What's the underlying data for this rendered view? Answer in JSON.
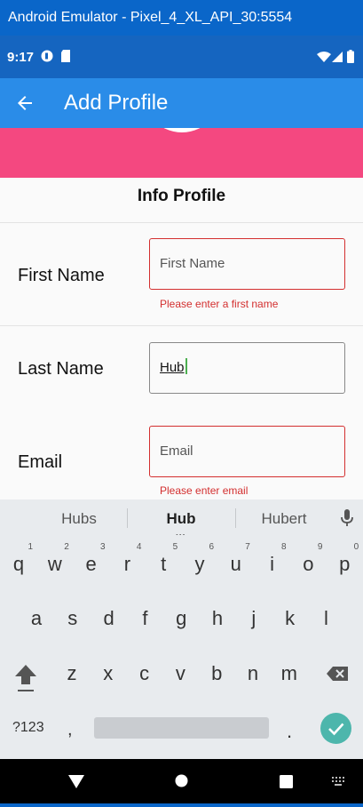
{
  "window": {
    "title": "Android Emulator - Pixel_4_XL_API_30:5554"
  },
  "status_bar": {
    "time": "9:17"
  },
  "app_bar": {
    "title": "Add Profile"
  },
  "section": {
    "title": "Info Profile"
  },
  "form": {
    "first_name": {
      "label": "First Name",
      "placeholder": "First Name",
      "value": "",
      "error": "Please enter a first name"
    },
    "last_name": {
      "label": "Last Name",
      "value": "Hub"
    },
    "email": {
      "label": "Email",
      "placeholder": "Email",
      "value": "",
      "error": "Please enter email"
    }
  },
  "suggestions": [
    "Hubs",
    "Hub",
    "Hubert"
  ],
  "keyboard": {
    "row1": [
      {
        "k": "q",
        "n": "1"
      },
      {
        "k": "w",
        "n": "2"
      },
      {
        "k": "e",
        "n": "3"
      },
      {
        "k": "r",
        "n": "4"
      },
      {
        "k": "t",
        "n": "5"
      },
      {
        "k": "y",
        "n": "6"
      },
      {
        "k": "u",
        "n": "7"
      },
      {
        "k": "i",
        "n": "8"
      },
      {
        "k": "o",
        "n": "9"
      },
      {
        "k": "p",
        "n": "0"
      }
    ],
    "row2": [
      "a",
      "s",
      "d",
      "f",
      "g",
      "h",
      "j",
      "k",
      "l"
    ],
    "row3": [
      "z",
      "x",
      "c",
      "v",
      "b",
      "n",
      "m"
    ],
    "symbols_label": "?123",
    "comma": ",",
    "period": "."
  },
  "colors": {
    "accent": "#2a8ce8",
    "error": "#d32f2f",
    "hero": "#f44880"
  }
}
